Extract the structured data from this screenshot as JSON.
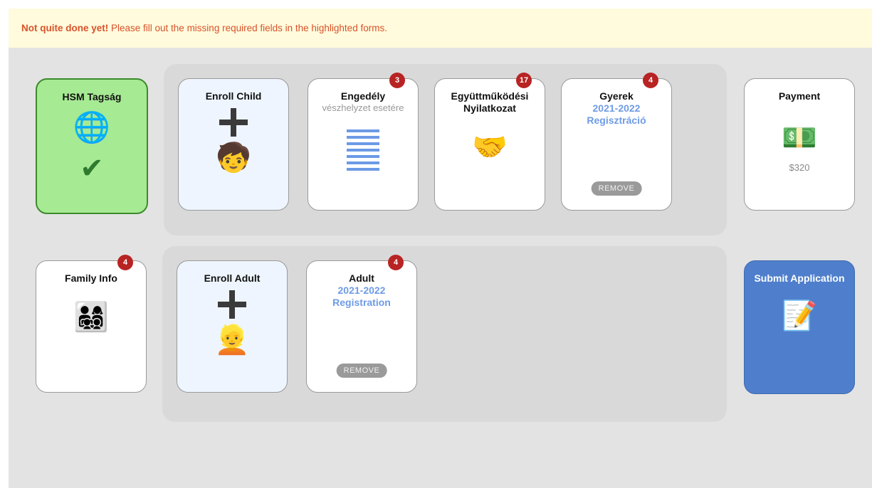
{
  "alert": {
    "strong": "Not quite done yet!",
    "text": " Please fill out the missing required fields in the highlighted forms."
  },
  "row1": {
    "membership": {
      "title": "HSM Tagság",
      "icon": "🌐",
      "check": "✔"
    },
    "enroll_child": {
      "title": "Enroll Child",
      "icon": "🧒"
    },
    "engedely": {
      "title": "Engedély",
      "subtitle": "vészhelyzet esetére",
      "badge": "3"
    },
    "nyilatkozat": {
      "title": "Együttműködési Nyilatkozat",
      "badge": "17",
      "icon": "🤝"
    },
    "gyerek": {
      "title": "Gyerek",
      "year": "2021-2022",
      "subtitle": "Regisztráció",
      "badge": "4",
      "remove": "REMOVE"
    },
    "payment": {
      "title": "Payment",
      "icon": "💵",
      "amount": "$320"
    }
  },
  "row2": {
    "family": {
      "title": "Family Info",
      "badge": "4",
      "icon": "👨‍👩‍👧‍👦"
    },
    "enroll_adult": {
      "title": "Enroll Adult",
      "icon": "👱"
    },
    "adult": {
      "title": "Adult",
      "year": "2021-2022",
      "subtitle": "Registration",
      "badge": "4",
      "remove": "REMOVE"
    },
    "submit": {
      "title": "Submit Application",
      "icon": "📝"
    }
  },
  "colors": {
    "alert_text": "#d9522b",
    "alert_bg": "#fffbdc",
    "badge": "#b82323",
    "done_bg": "#a6ea93",
    "submit_bg": "#4f7fcc",
    "year_text": "#6e9be6"
  }
}
